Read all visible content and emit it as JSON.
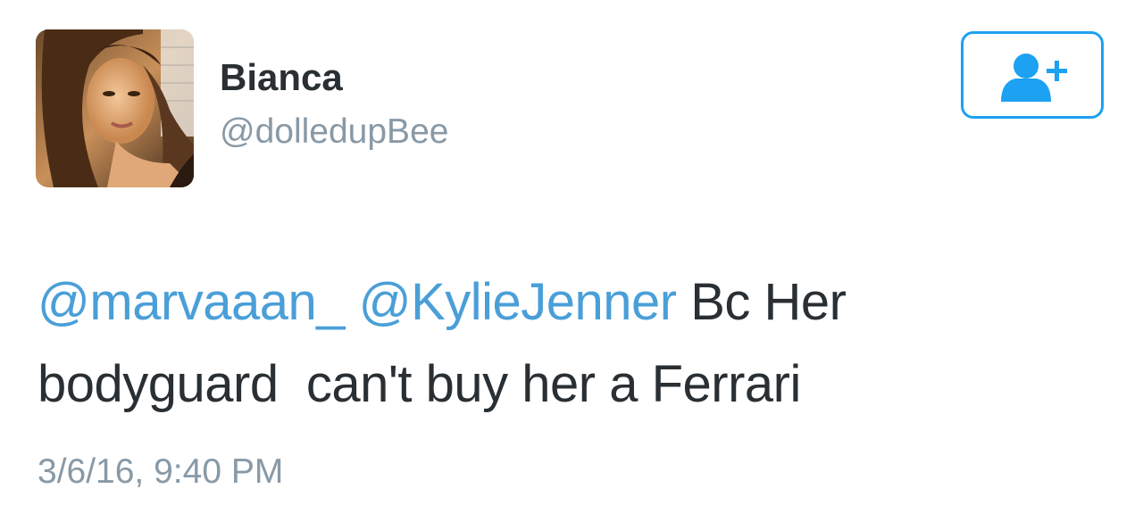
{
  "tweet": {
    "author": {
      "display_name": "Bianca",
      "handle": "@dolledupBee",
      "avatar": "profile-photo"
    },
    "follow_button": {
      "icon": "add-user-icon",
      "color": "#1da1f2"
    },
    "text": {
      "line1": {
        "mention1": "@marvaaan_",
        "mention2": "@KylieJenner",
        "rest": " Bc Her"
      },
      "line2": "bodyguard  can't buy her a Ferrari"
    },
    "timestamp": "3/6/16, 9:40 PM"
  },
  "colors": {
    "text": "#292f33",
    "muted": "#8899a6",
    "link": "#4a9fd8",
    "accent": "#1da1f2"
  }
}
